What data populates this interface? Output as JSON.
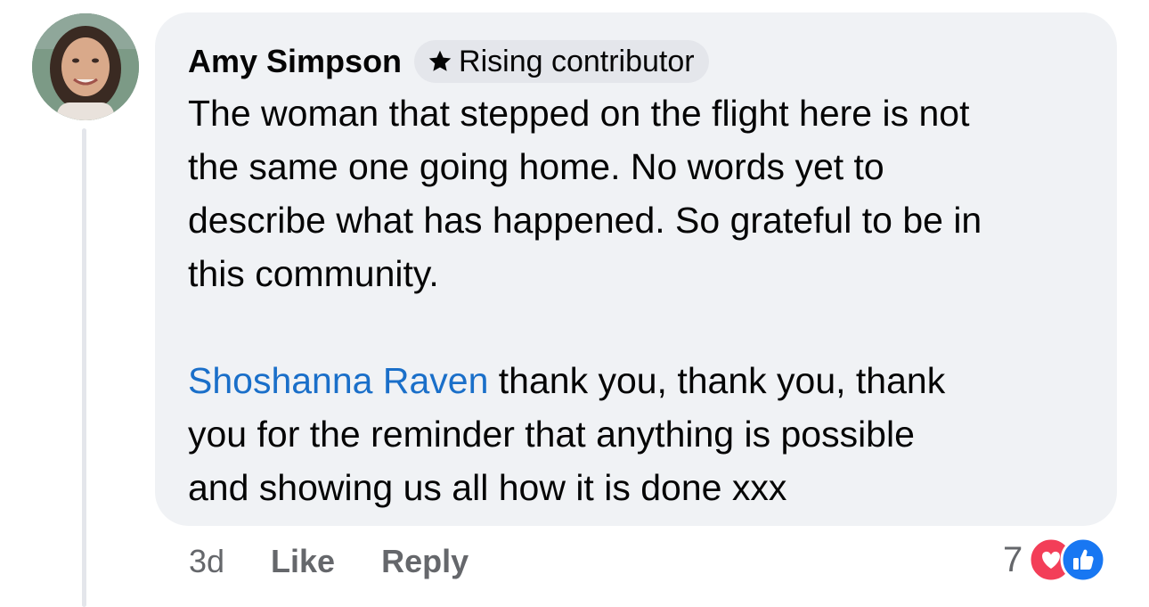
{
  "comment": {
    "author_name": "Amy Simpson",
    "badge_label": "Rising contributor",
    "badge_icon": "star-icon",
    "lines": [
      "The woman that stepped on the flight here is not",
      "the same one going home. No words yet to",
      "describe what has happened. So grateful to be in",
      "this community."
    ],
    "reply_mention": "Shoshanna Raven",
    "reply_lines": [
      " thank you, thank you, thank",
      "you for the reminder that anything is possible",
      "and showing us all how it is done xxx"
    ]
  },
  "actions": {
    "time": "3d",
    "like_label": "Like",
    "reply_label": "Reply"
  },
  "reactions": {
    "count": "7",
    "icons": [
      "love-icon",
      "like-icon"
    ],
    "love_color": "#f33e58",
    "like_color": "#1877f2"
  },
  "colors": {
    "bubble": "#f0f2f5",
    "mention": "#1a6fc9",
    "secondary_text": "#65676b"
  }
}
